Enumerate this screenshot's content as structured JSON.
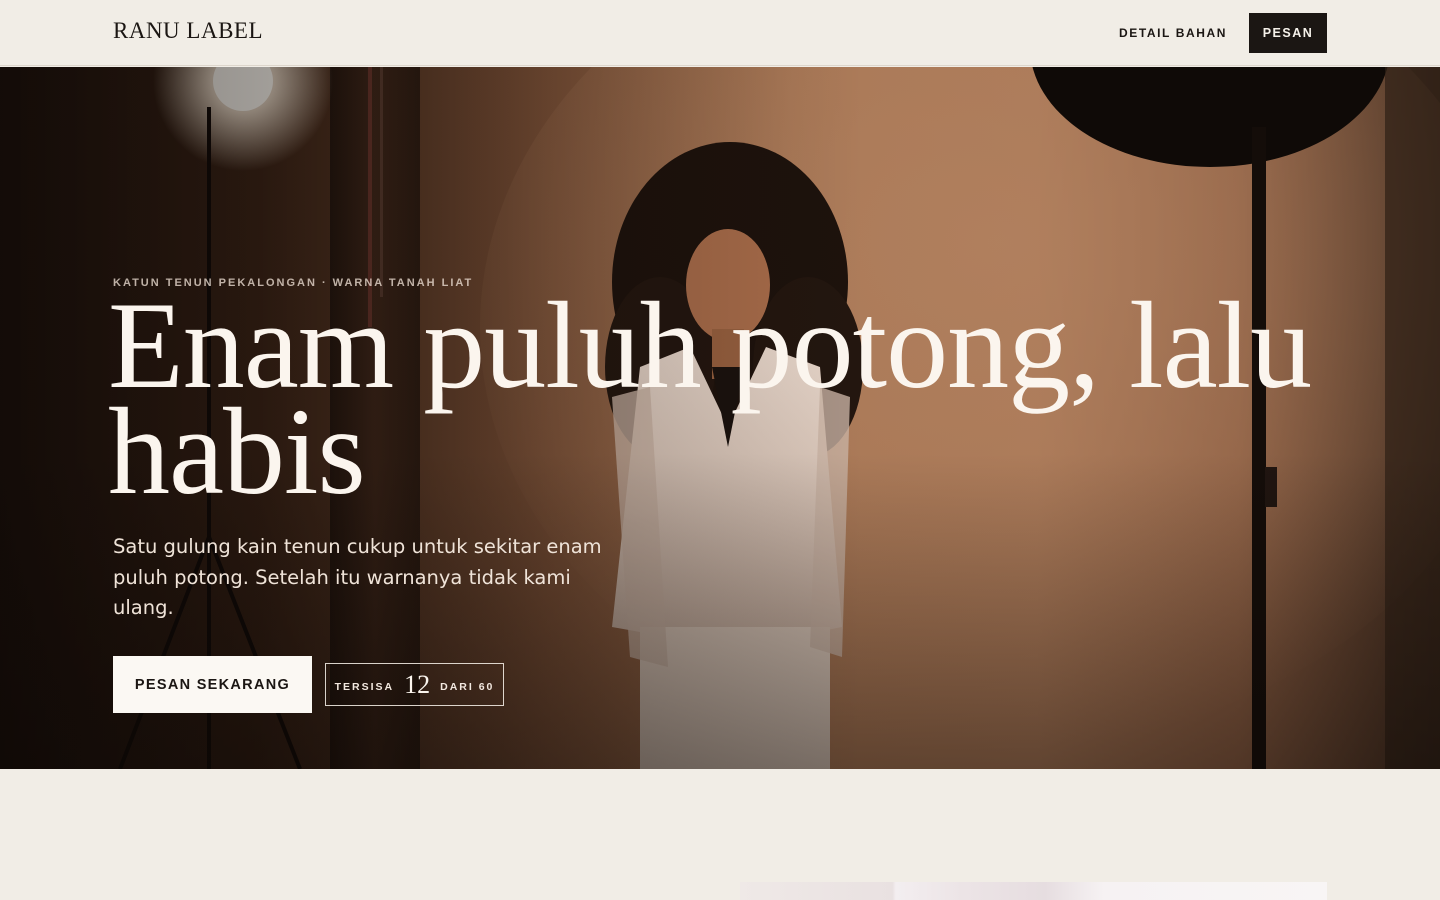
{
  "header": {
    "logo": "RANU LABEL",
    "nav_link": "DETAIL BAHAN",
    "cta": "PESAN"
  },
  "hero": {
    "eyebrow": "KATUN TENUN PEKALONGAN · WARNA TANAH LIAT",
    "headline": "Enam puluh potong, lalu habis",
    "lede": "Satu gulung kain tenun cukup untuk sekitar enam puluh potong. Setelah itu warnanya tidak kami ulang.",
    "primary_button": "PESAN SEKARANG",
    "stock": {
      "prefix": "TERSISA",
      "count": "12",
      "suffix": "DARI 60"
    }
  },
  "colors": {
    "background": "#f1ede6",
    "ink": "#1b1613",
    "hero_tone": "#a57452",
    "hero_text": "#fbf5ee"
  },
  "icons": [
    "studio-lamp",
    "light-stand",
    "softbox"
  ]
}
